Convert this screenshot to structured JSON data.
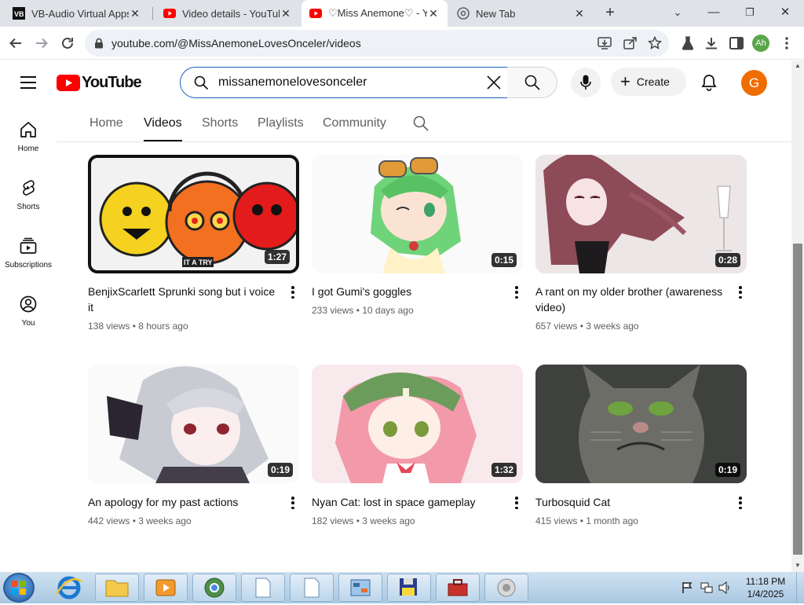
{
  "browser": {
    "tabs": [
      {
        "title": "VB-Audio Virtual Apps",
        "favicon": "vb-audio-icon",
        "active": false
      },
      {
        "title": "Video details - YouTube",
        "favicon": "youtube-icon",
        "active": false
      },
      {
        "title": "♡Miss Anemone♡ - YouTube",
        "favicon": "youtube-icon",
        "active": true
      },
      {
        "title": "New Tab",
        "favicon": "chrome-icon",
        "active": false
      }
    ],
    "url": "youtube.com/@MissAnemoneLovesOnceler/videos",
    "profile_initials": "Ah",
    "accent_color": "#1a73e8"
  },
  "youtube": {
    "logo_text": "YouTube",
    "search_value": "missanemonelovesonceler",
    "create_label": "Create",
    "avatar_letter": "G",
    "sidebar": [
      {
        "label": "Home",
        "icon": "home-icon"
      },
      {
        "label": "Shorts",
        "icon": "shorts-icon"
      },
      {
        "label": "Subscriptions",
        "icon": "subscriptions-icon"
      },
      {
        "label": "You",
        "icon": "you-icon"
      }
    ],
    "channel_tabs": [
      {
        "label": "Home",
        "active": false
      },
      {
        "label": "Videos",
        "active": true
      },
      {
        "label": "Shorts",
        "active": false
      },
      {
        "label": "Playlists",
        "active": false
      },
      {
        "label": "Community",
        "active": false
      }
    ],
    "videos": [
      {
        "title": "BenjixScarlett Sprunki song but i voice it",
        "meta": "138 views • 8 hours ago",
        "duration": "1:27",
        "thumb_color": "#e8562b"
      },
      {
        "title": "I got Gumi's goggles",
        "meta": "233 views • 10 days ago",
        "duration": "0:15",
        "thumb_color": "#7cc38b"
      },
      {
        "title": "A rant on my older brother (awareness video)",
        "meta": "657 views • 3 weeks ago",
        "duration": "0:28",
        "thumb_color": "#a8737e"
      },
      {
        "title": "An apology for my past actions",
        "meta": "442 views • 3 weeks ago",
        "duration": "0:19",
        "thumb_color": "#c7c9cf"
      },
      {
        "title": "Nyan Cat: lost in space gameplay",
        "meta": "182 views • 3 weeks ago",
        "duration": "1:32",
        "thumb_color": "#f1a7b5"
      },
      {
        "title": "Turbosquid Cat",
        "meta": "415 views • 1 month ago",
        "duration": "0:19",
        "thumb_color": "#5d5f5a"
      }
    ]
  },
  "taskbar": {
    "time": "11:18 PM",
    "date": "1/4/2025"
  }
}
